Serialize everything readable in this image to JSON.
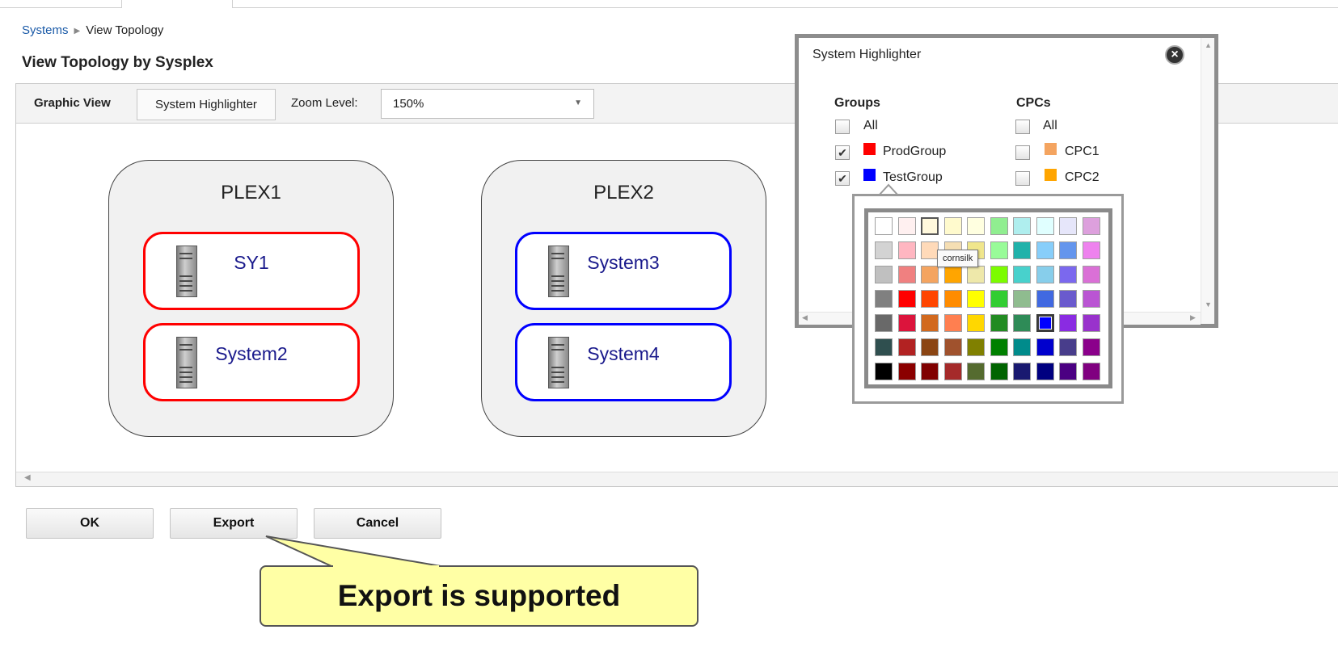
{
  "breadcrumb": {
    "parent": "Systems",
    "current": "View Topology"
  },
  "page_title": "View Topology by Sysplex",
  "toolbar": {
    "graphic_view_label": "Graphic View",
    "highlighter_button": "System Highlighter",
    "zoom_label": "Zoom Level:",
    "zoom_value": "150%"
  },
  "topology": {
    "plexes": [
      {
        "name": "PLEX1",
        "systems": [
          {
            "name": "SY1",
            "group_color": "#ff0000"
          },
          {
            "name": "System2",
            "group_color": "#ff0000"
          }
        ]
      },
      {
        "name": "PLEX2",
        "systems": [
          {
            "name": "System3",
            "group_color": "#0000ff"
          },
          {
            "name": "System4",
            "group_color": "#0000ff"
          }
        ]
      }
    ]
  },
  "buttons": {
    "ok": "OK",
    "export": "Export",
    "cancel": "Cancel"
  },
  "callout_text": "Export is supported",
  "highlighter": {
    "title": "System Highlighter",
    "groups_heading": "Groups",
    "cpcs_heading": "CPCs",
    "groups": [
      {
        "label": "All",
        "checked": false,
        "color": null
      },
      {
        "label": "ProdGroup",
        "checked": true,
        "color": "#ff0000"
      },
      {
        "label": "TestGroup",
        "checked": true,
        "color": "#0000ff"
      }
    ],
    "cpcs": [
      {
        "label": "All",
        "checked": false,
        "color": null
      },
      {
        "label": "CPC1",
        "checked": false,
        "color": "#f4a460"
      },
      {
        "label": "CPC2",
        "checked": false,
        "color": "#ffa500"
      }
    ]
  },
  "color_picker": {
    "hover_tooltip": "cornsilk",
    "selected_color": "#0000ff",
    "rows": [
      [
        "#ffffff",
        "#fff0f0",
        "#fff8dc",
        "#fffacd",
        "#ffffe0",
        "#90ee90",
        "#afeeee",
        "#e0ffff",
        "#e6e6fa",
        "#dda0dd"
      ],
      [
        "#d3d3d3",
        "#ffb6c1",
        "#ffdab9",
        "#f5deb3",
        "#f0e68c",
        "#98fb98",
        "#20b2aa",
        "#87cefa",
        "#6495ed",
        "#ee82ee"
      ],
      [
        "#c0c0c0",
        "#f08080",
        "#f4a460",
        "#ffa500",
        "#eee8aa",
        "#7cfc00",
        "#48d1cc",
        "#87ceeb",
        "#7b68ee",
        "#da70d6"
      ],
      [
        "#808080",
        "#ff0000",
        "#ff4500",
        "#ff8c00",
        "#ffff00",
        "#32cd32",
        "#8fbc8f",
        "#4169e1",
        "#6a5acd",
        "#ba55d3"
      ],
      [
        "#696969",
        "#dc143c",
        "#d2691e",
        "#ff7f50",
        "#ffd700",
        "#228b22",
        "#2e8b57",
        "#0000ff",
        "#8a2be2",
        "#9932cc"
      ],
      [
        "#2f4f4f",
        "#b22222",
        "#8b4513",
        "#a0522d",
        "#808000",
        "#008000",
        "#008b8b",
        "#0000cd",
        "#483d8b",
        "#8b008b"
      ],
      [
        "#000000",
        "#8b0000",
        "#800000",
        "#a52a2a",
        "#556b2f",
        "#006400",
        "#191970",
        "#000080",
        "#4b0082",
        "#800080"
      ]
    ]
  }
}
